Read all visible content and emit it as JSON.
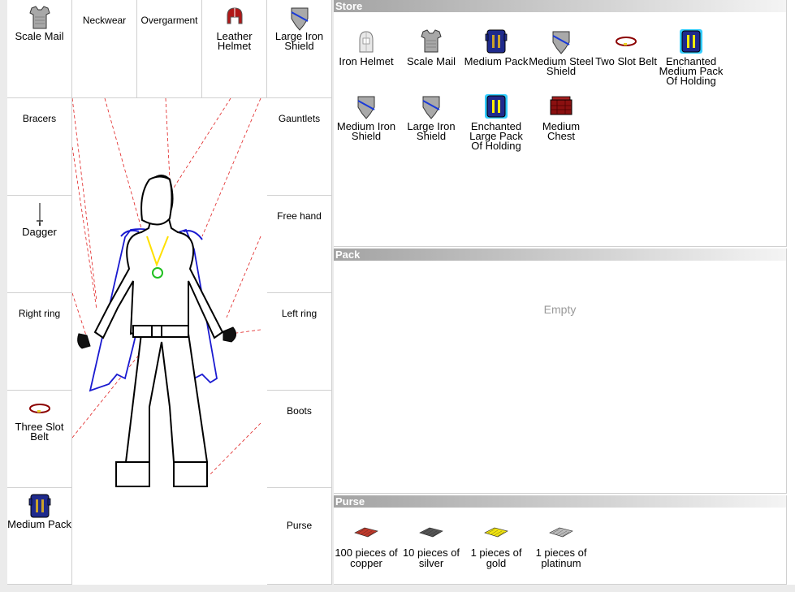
{
  "equipment": {
    "head_row": [
      {
        "label": "Scale Mail",
        "icon": "scale-mail-icon"
      },
      {
        "label": "Neckwear",
        "icon": null
      },
      {
        "label": "Overgarment",
        "icon": null
      },
      {
        "label": "Leather Helmet",
        "icon": "leather-helmet-icon"
      },
      {
        "label": "Large Iron Shield",
        "icon": "large-iron-shield-icon"
      }
    ],
    "left_column": [
      {
        "label": "Bracers",
        "icon": null
      },
      {
        "label": "Dagger",
        "icon": "dagger-icon"
      },
      {
        "label": "Right ring",
        "icon": null
      },
      {
        "label": "Three Slot Belt",
        "icon": "belt-icon"
      },
      {
        "label": "Medium Pack",
        "icon": "medium-pack-icon"
      }
    ],
    "right_column": [
      {
        "label": "Gauntlets",
        "icon": null
      },
      {
        "label": "Free hand",
        "icon": null
      },
      {
        "label": "Left ring",
        "icon": null
      },
      {
        "label": "Boots",
        "icon": null
      },
      {
        "label": "Purse",
        "icon": null
      }
    ]
  },
  "store": {
    "title": "Store",
    "items": [
      {
        "label": "Iron Helmet",
        "icon": "iron-helmet-icon"
      },
      {
        "label": "Scale Mail",
        "icon": "scale-mail-icon"
      },
      {
        "label": "Medium Pack",
        "icon": "medium-pack-icon"
      },
      {
        "label": "Medium Steel Shield",
        "icon": "steel-shield-icon"
      },
      {
        "label": "Two Slot Belt",
        "icon": "belt-icon"
      },
      {
        "label": "Enchanted Medium Pack Of Holding",
        "icon": "enchanted-pack-icon"
      },
      {
        "label": "Medium Iron Shield",
        "icon": "iron-shield-icon"
      },
      {
        "label": "Large Iron Shield",
        "icon": "iron-shield-icon"
      },
      {
        "label": "Enchanted Large Pack Of Holding",
        "icon": "enchanted-pack-icon"
      },
      {
        "label": "Medium Chest",
        "icon": "chest-icon"
      }
    ]
  },
  "pack": {
    "title": "Pack",
    "empty_text": "Empty"
  },
  "purse": {
    "title": "Purse",
    "coins": [
      {
        "label": "100 pieces of copper",
        "icon": "copper-coins-icon",
        "color": "#c0392b"
      },
      {
        "label": "10 pieces of silver",
        "icon": "silver-coins-icon",
        "color": "#555555"
      },
      {
        "label": "1 pieces of gold",
        "icon": "gold-coins-icon",
        "color": "#f1e40f"
      },
      {
        "label": "1 pieces of platinum",
        "icon": "platinum-coins-icon",
        "color": "#bbbbbb"
      }
    ]
  }
}
